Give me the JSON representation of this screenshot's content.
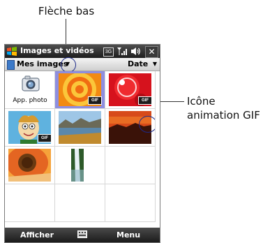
{
  "callouts": {
    "down_arrow": "Flèche bas",
    "gif_icon_line1": "Icône",
    "gif_icon_line2": "animation GIF"
  },
  "window": {
    "title": "Images et vidéos",
    "status_3g": "3G",
    "close_label": "✕"
  },
  "toolbar": {
    "folder_name": "Mes images",
    "folder_dropdown": "▼",
    "sort_label": "Date",
    "sort_dropdown": "▼"
  },
  "grid": {
    "camera_label": "App. photo",
    "gif_badge": "GIF"
  },
  "softkeys": {
    "left": "Afficher",
    "right": "Menu"
  },
  "colors": {
    "selection": "#8e8ee0",
    "titlebar": "#1d1d1d",
    "callout_circle": "#1d2a8a"
  },
  "icons": [
    "windows-logo-icon",
    "signal-icon",
    "volume-icon",
    "close-icon",
    "folder-icon",
    "chevron-down-icon",
    "camera-icon",
    "gif-badge-icon",
    "keyboard-icon"
  ]
}
